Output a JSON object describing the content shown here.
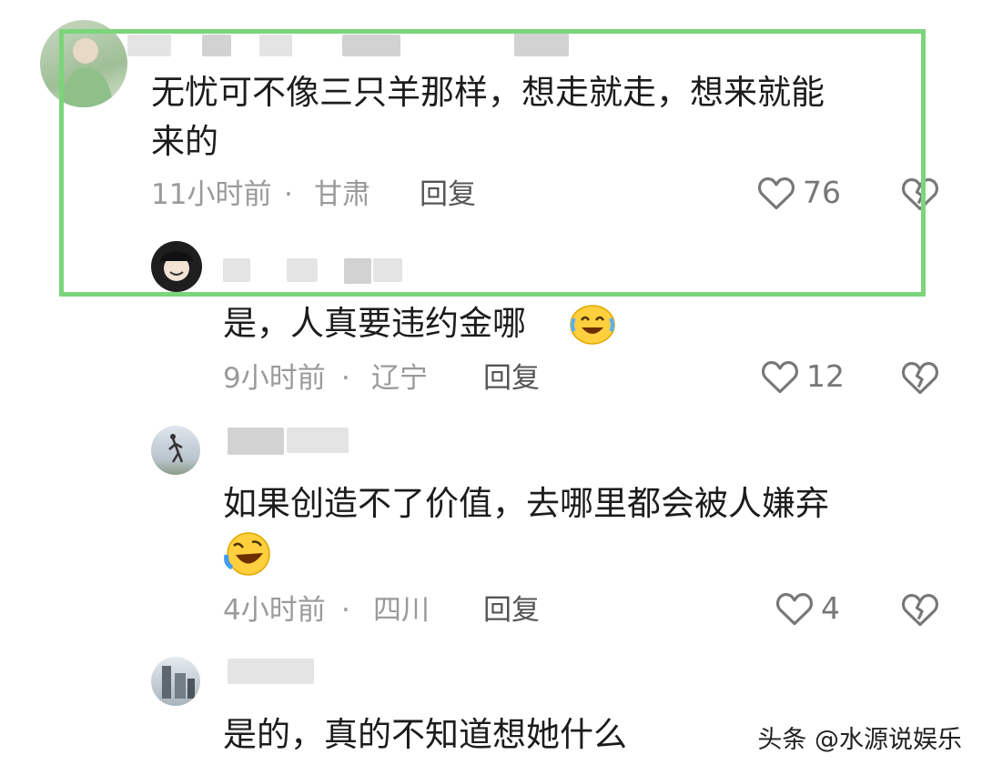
{
  "comments": [
    {
      "text_lines": [
        "无忧可不像三只羊那样，想走就走，想来就能",
        "来的"
      ],
      "time": "11小时前",
      "location": "甘肃",
      "reply_label": "回复",
      "likes": "76"
    },
    {
      "text_lines": [
        "是，人真要违约金哪"
      ],
      "emoji": "laughing-tears-emoji",
      "time": "9小时前",
      "location": "辽宁",
      "reply_label": "回复",
      "likes": "12"
    },
    {
      "text_lines": [
        "如果创造不了价值，去哪里都会被人嫌弃"
      ],
      "emoji": "rolling-laughing-emoji",
      "time": "4小时前",
      "location": "四川",
      "reply_label": "回复",
      "likes": "4"
    },
    {
      "text_lines": [
        "是的，真的不知道想她什么"
      ]
    }
  ],
  "separator": "·",
  "watermark": "头条 @水源说娱乐",
  "colors": {
    "highlight": "#7bd57a",
    "meta": "#9a9a9a"
  },
  "icons": {
    "like": "heart-outline-icon",
    "dislike": "broken-heart-icon"
  }
}
